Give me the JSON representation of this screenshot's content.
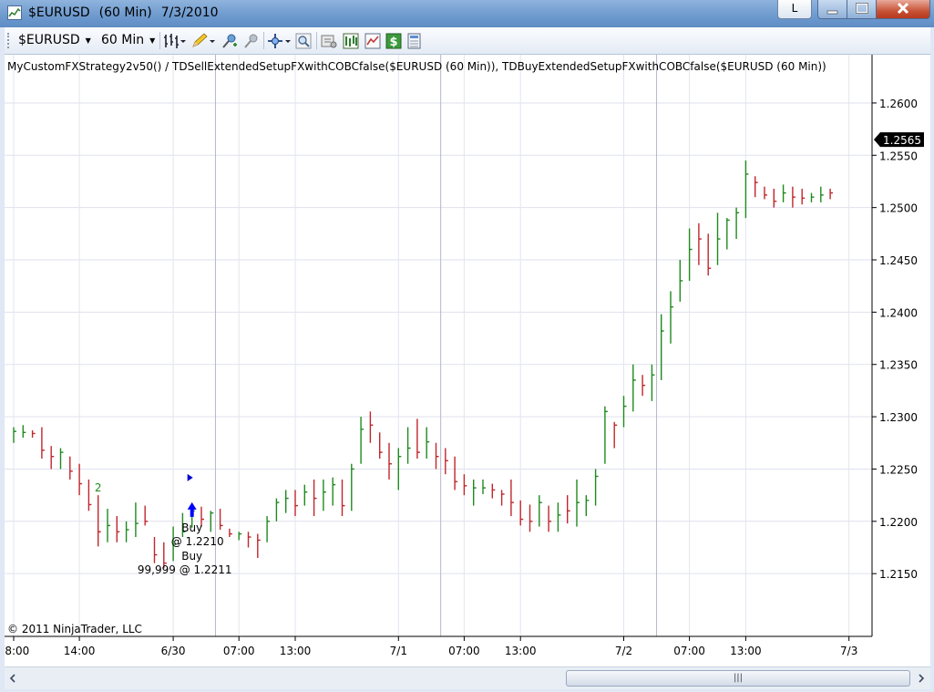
{
  "window": {
    "instrument": "$EURUSD",
    "interval": "(60 Min)",
    "date": "7/3/2010",
    "link_button": "L"
  },
  "toolbar": {
    "instrument": "$EURUSD",
    "interval": "60 Min"
  },
  "chart": {
    "label": "MyCustomFXStrategy2v50()  /  TDSellExtendedSetupFXwithCOBCfalse($EURUSD  (60  Min)),  TDBuyExtendedSetupFXwithCOBCfalse($EURUSD  (60  Min))",
    "copyright": "© 2011 NinjaTrader, LLC",
    "last_price": "1.2565",
    "buy_markers": [
      {
        "bar": 19,
        "price": 1.2206,
        "label": "Buy",
        "detail": "@ 1.2210"
      },
      {
        "bar": 19,
        "price": 1.2206,
        "label": "Buy",
        "detail": "99,999 @ 1.2211"
      }
    ],
    "scrollbar_grip": "|||"
  },
  "chart_data": {
    "type": "ohlc",
    "ylim": [
      1.209,
      1.262
    ],
    "y_ticks": [
      "1.2600",
      "1.2550",
      "1.2500",
      "1.2450",
      "1.2400",
      "1.2350",
      "1.2300",
      "1.2250",
      "1.2200",
      "1.2150"
    ],
    "x_ticks": [
      {
        "bar": 0,
        "label": "08:00"
      },
      {
        "bar": 7,
        "label": "14:00"
      },
      {
        "bar": 17,
        "label": "6/30"
      },
      {
        "bar": 24,
        "label": "07:00"
      },
      {
        "bar": 30,
        "label": "13:00"
      },
      {
        "bar": 41,
        "label": "7/1"
      },
      {
        "bar": 48,
        "label": "07:00"
      },
      {
        "bar": 54,
        "label": "13:00"
      },
      {
        "bar": 65,
        "label": "7/2"
      },
      {
        "bar": 72,
        "label": "07:00"
      },
      {
        "bar": 78,
        "label": "13:00"
      },
      {
        "bar": 89,
        "label": "7/3"
      }
    ],
    "bars": [
      [
        1.229,
        1.2275,
        1.2286,
        1
      ],
      [
        1.2292,
        1.228,
        1.2285,
        1
      ],
      [
        1.2287,
        1.228,
        1.2284,
        0
      ],
      [
        1.229,
        1.226,
        1.2268,
        0
      ],
      [
        1.2272,
        1.225,
        1.2262,
        0
      ],
      [
        1.227,
        1.225,
        1.2266,
        1
      ],
      [
        1.2262,
        1.224,
        1.2248,
        0
      ],
      [
        1.2255,
        1.2225,
        1.2236,
        0
      ],
      [
        1.224,
        1.221,
        1.2216,
        0
      ],
      [
        1.2225,
        1.2176,
        1.219,
        0
      ],
      [
        1.2212,
        1.218,
        1.2196,
        1
      ],
      [
        1.2205,
        1.218,
        1.219,
        0
      ],
      [
        1.22,
        1.218,
        1.2192,
        1
      ],
      [
        1.2218,
        1.2185,
        1.2198,
        1
      ],
      [
        1.2215,
        1.2196,
        1.22,
        0
      ],
      [
        1.2185,
        1.216,
        1.2168,
        0
      ],
      [
        1.218,
        1.2155,
        1.216,
        0
      ],
      [
        1.2195,
        1.2162,
        1.2178,
        1
      ],
      [
        1.2208,
        1.2185,
        1.219,
        1
      ],
      [
        1.2216,
        1.2194,
        1.221,
        1
      ],
      [
        1.2214,
        1.2195,
        1.2202,
        0
      ],
      [
        1.221,
        1.219,
        1.2208,
        1
      ],
      [
        1.2212,
        1.2192,
        1.2196,
        0
      ],
      [
        1.2193,
        1.2185,
        1.2188,
        0
      ],
      [
        1.219,
        1.2182,
        1.2188,
        1
      ],
      [
        1.219,
        1.2175,
        1.2185,
        0
      ],
      [
        1.2188,
        1.2165,
        1.2182,
        0
      ],
      [
        1.2205,
        1.218,
        1.22,
        1
      ],
      [
        1.2222,
        1.22,
        1.2218,
        1
      ],
      [
        1.223,
        1.2208,
        1.2222,
        1
      ],
      [
        1.223,
        1.2205,
        1.2215,
        0
      ],
      [
        1.2235,
        1.2215,
        1.2228,
        1
      ],
      [
        1.224,
        1.2205,
        1.2222,
        0
      ],
      [
        1.224,
        1.221,
        1.2228,
        1
      ],
      [
        1.2242,
        1.2215,
        1.2235,
        1
      ],
      [
        1.224,
        1.2205,
        1.2215,
        0
      ],
      [
        1.2255,
        1.221,
        1.225,
        1
      ],
      [
        1.23,
        1.2255,
        1.2288,
        1
      ],
      [
        1.2305,
        1.2275,
        1.2292,
        0
      ],
      [
        1.2285,
        1.226,
        1.2266,
        0
      ],
      [
        1.2275,
        1.224,
        1.2255,
        0
      ],
      [
        1.227,
        1.223,
        1.2262,
        1
      ],
      [
        1.229,
        1.2255,
        1.227,
        1
      ],
      [
        1.2298,
        1.226,
        1.2266,
        0
      ],
      [
        1.229,
        1.226,
        1.2276,
        1
      ],
      [
        1.2275,
        1.225,
        1.2262,
        0
      ],
      [
        1.227,
        1.2245,
        1.2258,
        0
      ],
      [
        1.2262,
        1.223,
        1.2238,
        0
      ],
      [
        1.2245,
        1.2225,
        1.2234,
        0
      ],
      [
        1.224,
        1.2215,
        1.2232,
        1
      ],
      [
        1.224,
        1.2226,
        1.2232,
        1
      ],
      [
        1.2236,
        1.2222,
        1.223,
        0
      ],
      [
        1.223,
        1.2215,
        1.2226,
        0
      ],
      [
        1.224,
        1.2205,
        1.2218,
        0
      ],
      [
        1.222,
        1.2196,
        1.2202,
        0
      ],
      [
        1.2216,
        1.219,
        1.22,
        0
      ],
      [
        1.2225,
        1.2195,
        1.2218,
        1
      ],
      [
        1.2215,
        1.219,
        1.22,
        0
      ],
      [
        1.2218,
        1.219,
        1.2206,
        1
      ],
      [
        1.2225,
        1.2198,
        1.221,
        0
      ],
      [
        1.224,
        1.2195,
        1.2218,
        1
      ],
      [
        1.2225,
        1.2205,
        1.222,
        1
      ],
      [
        1.225,
        1.2215,
        1.2243,
        1
      ],
      [
        1.231,
        1.2255,
        1.2305,
        1
      ],
      [
        1.2295,
        1.227,
        1.2292,
        0
      ],
      [
        1.232,
        1.229,
        1.231,
        1
      ],
      [
        1.235,
        1.2305,
        1.2335,
        1
      ],
      [
        1.234,
        1.232,
        1.233,
        0
      ],
      [
        1.235,
        1.2315,
        1.234,
        1
      ],
      [
        1.2398,
        1.2335,
        1.2382,
        1
      ],
      [
        1.242,
        1.237,
        1.2405,
        1
      ],
      [
        1.245,
        1.241,
        1.243,
        1
      ],
      [
        1.248,
        1.243,
        1.246,
        1
      ],
      [
        1.2485,
        1.2445,
        1.247,
        0
      ],
      [
        1.2475,
        1.2435,
        1.2442,
        0
      ],
      [
        1.2495,
        1.2445,
        1.247,
        1
      ],
      [
        1.249,
        1.246,
        1.2488,
        1
      ],
      [
        1.25,
        1.247,
        1.2495,
        1
      ],
      [
        1.2545,
        1.249,
        1.2532,
        1
      ],
      [
        1.253,
        1.251,
        1.2524,
        0
      ],
      [
        1.252,
        1.2508,
        1.2512,
        0
      ],
      [
        1.2518,
        1.25,
        1.2506,
        0
      ],
      [
        1.2522,
        1.2505,
        1.2514,
        1
      ],
      [
        1.252,
        1.25,
        1.251,
        0
      ],
      [
        1.2518,
        1.2503,
        1.2509,
        0
      ],
      [
        1.2514,
        1.2505,
        1.251,
        1
      ],
      [
        1.252,
        1.2505,
        1.2512,
        1
      ],
      [
        1.2518,
        1.2508,
        1.2514,
        0
      ]
    ],
    "count_labels": [
      {
        "bar": 9,
        "pos": "above",
        "text": "2"
      }
    ]
  }
}
